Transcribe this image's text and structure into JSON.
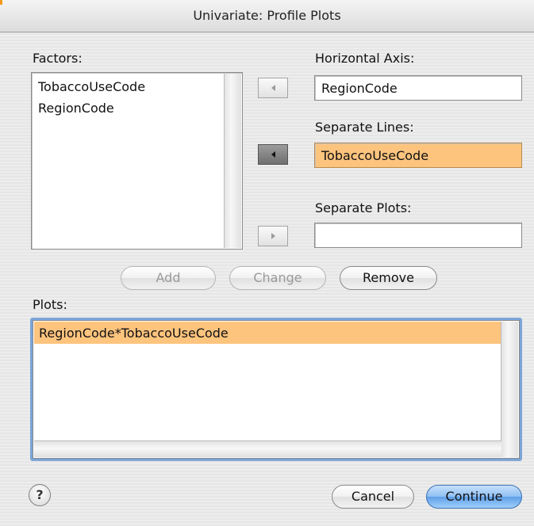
{
  "window": {
    "title": "Univariate: Profile Plots"
  },
  "factors": {
    "label": "Factors:",
    "items": [
      "TobaccoUseCode",
      "RegionCode"
    ]
  },
  "horizontal_axis": {
    "label": "Horizontal Axis:",
    "value": "RegionCode"
  },
  "separate_lines": {
    "label": "Separate Lines:",
    "value": "TobaccoUseCode"
  },
  "separate_plots": {
    "label": "Separate Plots:",
    "value": ""
  },
  "buttons": {
    "add": "Add",
    "change": "Change",
    "remove": "Remove",
    "cancel": "Cancel",
    "continue": "Continue",
    "help": "?"
  },
  "plots": {
    "label": "Plots:",
    "items": [
      "RegionCode*TobaccoUseCode"
    ]
  },
  "colors": {
    "selection": "#fdc47e",
    "default_button": "#5f9ee8",
    "focus_ring": "#7ba5d8"
  },
  "icons": {
    "move_left": "triangle-left",
    "move_right": "triangle-right",
    "help": "question-mark"
  }
}
